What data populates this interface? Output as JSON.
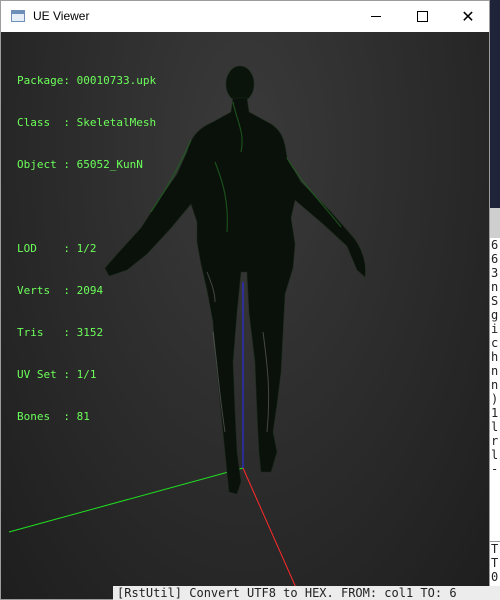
{
  "window": {
    "title": "UE Viewer"
  },
  "info": {
    "package_label": "Package:",
    "package": "00010733.upk",
    "class_label": "Class  :",
    "class": "SkeletalMesh",
    "object_label": "Object :",
    "object": "65052_KunN",
    "lod_label": "LOD    :",
    "lod": "1/2",
    "verts_label": "Verts  :",
    "verts": "2094",
    "tris_label": "Tris   :",
    "tris": "3152",
    "uvset_label": "UV Set :",
    "uvset": "1/1",
    "bones_label": "Bones  :",
    "bones": "81"
  },
  "console": {
    "visible_chars": "6\n6\n3\nn\nS\ng\ni\nc\nh\nn\nn\n)\n1\nl\nr\nl\n-",
    "visible_chars_bottom": "T\nT\n0"
  },
  "desktop_glyph": "M",
  "taskbar_text": "[RstUtil] Convert UTF8 to HEX. FROM: col1  TO: 6",
  "colors": {
    "info_text": "#6cff5a",
    "axis_x": "#ff2a2a",
    "axis_y": "#20e020",
    "axis_z": "#2a2aff"
  }
}
